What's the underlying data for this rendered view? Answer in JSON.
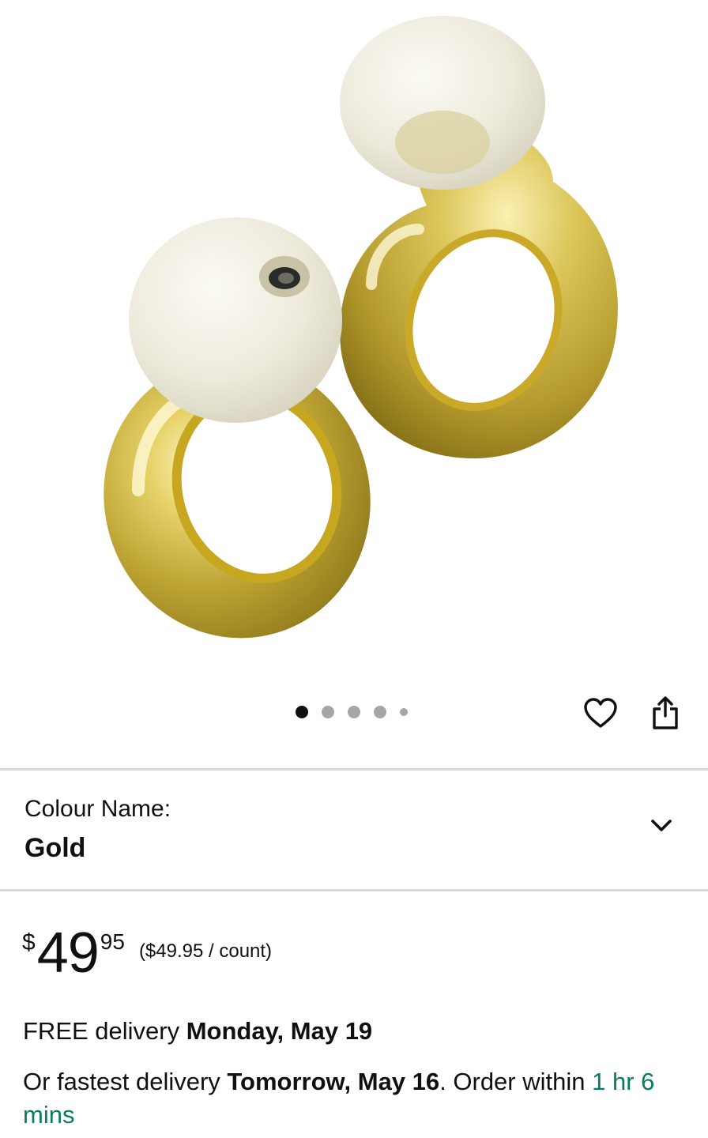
{
  "gallery": {
    "image_count": 5,
    "active_index": 0,
    "wishlist_icon": "heart-icon",
    "share_icon": "share-icon"
  },
  "variant": {
    "label": "Colour Name:",
    "value": "Gold",
    "chevron_icon": "chevron-down-icon"
  },
  "price": {
    "symbol": "$",
    "whole": "49",
    "fraction": "95",
    "per_unit": "($49.95 / count)"
  },
  "delivery": {
    "free_prefix": "FREE delivery ",
    "free_date": "Monday, May 19",
    "fast_prefix": "Or fastest delivery ",
    "fast_date": "Tomorrow, May 16",
    "order_within": ". Order within ",
    "countdown": "1 hr 6 mins"
  },
  "colors": {
    "text": "#0f1111",
    "divider": "#d5d9d9",
    "green": "#067d62",
    "gold": "#c9b33a"
  }
}
